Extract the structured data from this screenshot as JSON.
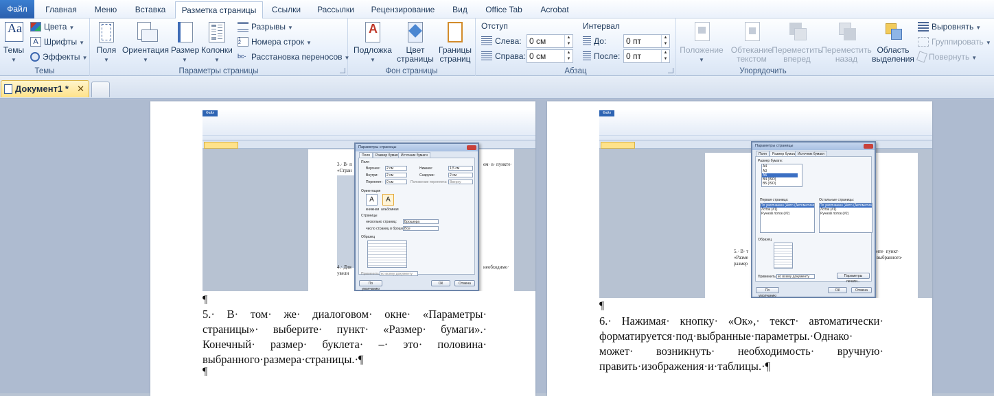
{
  "ribbon": {
    "tabs": [
      "Файл",
      "Главная",
      "Меню",
      "Вставка",
      "Разметка страницы",
      "Ссылки",
      "Рассылки",
      "Рецензирование",
      "Вид",
      "Office Tab",
      "Acrobat"
    ],
    "active_tab": "Разметка страницы",
    "groups": {
      "themes": {
        "label": "Темы",
        "themes_btn": "Темы",
        "colors": "Цвета",
        "fonts": "Шрифты",
        "effects": "Эффекты"
      },
      "page_setup": {
        "label": "Параметры страницы",
        "fields": "Поля",
        "orientation": "Ориентация",
        "size": "Размер",
        "columns": "Колонки",
        "breaks": "Разрывы",
        "line_numbers": "Номера строк",
        "hyphenation": "Расстановка переносов"
      },
      "page_background": {
        "label": "Фон страницы",
        "watermark": "Подложка",
        "page_color": "Цвет\nстраницы",
        "page_borders": "Границы\nстраниц"
      },
      "paragraph": {
        "label": "Абзац",
        "indent_title": "Отступ",
        "left_label": "Слева:",
        "left_value": "0 см",
        "right_label": "Справа:",
        "right_value": "0 см",
        "spacing_title": "Интервал",
        "before_label": "До:",
        "before_value": "0 пт",
        "after_label": "После:",
        "after_value": "0 пт"
      },
      "arrange": {
        "label": "Упорядочить",
        "position": "Положение",
        "wrap_text": "Обтекание\nтекстом",
        "bring_forward": "Переместить\nвперед",
        "send_backward": "Переместить\nназад",
        "selection_pane": "Область\nвыделения",
        "align": "Выровнять",
        "group": "Группировать",
        "rotate": "Повернуть"
      }
    }
  },
  "document_tabs": {
    "active": "Документ1 *",
    "close_glyph": "✕"
  },
  "page_left": {
    "para_text": "5.· В· том· же· диалоговом· окне· «Параметры· страницы»· выберите· пункт· «Размер· бумаги».· Конечный· размер· буклета· –· это· половина· выбранного·размера·страницы.·¶",
    "pilcrow": "¶",
    "screenshot": {
      "dialog_title": "Параметры страницы",
      "tabs": [
        "Поля",
        "Размер бумаги",
        "Источник бумаги"
      ],
      "section_fields": "Поля",
      "top_label": "Верхнее:",
      "top_value": "2 см",
      "bottom_label": "Нижнее:",
      "bottom_value": "1,5 см",
      "inner_label": "Внутри:",
      "inner_value": "2 см",
      "outer_label": "Снаружи:",
      "outer_value": "2 см",
      "gutter_label": "Переплет:",
      "gutter_value": "0 см",
      "gutter_pos_label": "Положение переплета:",
      "gutter_pos_value": "Вверху",
      "section_orientation": "Ориентация",
      "portrait": "книжная",
      "landscape": "альбомная",
      "section_pages": "Страницы",
      "multiple_label": "несколько страниц:",
      "multiple_value": "Брошюра",
      "sheets_label": "число страниц в брошюре:",
      "sheets_value": "Все",
      "section_sample": "Образец",
      "apply_label": "Применить:",
      "apply_value": "ко всему документу",
      "default_btn": "По умолчанию",
      "ok_btn": "ОК",
      "cancel_btn": "Отмена",
      "bg_text_1": "3.· В· п",
      "bg_text_1b": "ем· в· пункте·",
      "bg_text_2": "«Стран",
      "bg_text_3": "4.· Для",
      "bg_text_3b": "необходимо·",
      "bg_text_4": "увели"
    }
  },
  "page_right": {
    "para_text": "6.· Нажимая· кнопку· «Ок»,· текст· автоматически· форматируется·под·выбранные·параметры.·Однако· может· возникнуть· необходимость· вручную· править·изображения·и·таблицы.·¶",
    "pilcrow": "¶",
    "screenshot": {
      "dialog_title": "Параметры страницы",
      "tabs": [
        "Поля",
        "Размер бумаги",
        "Источник бумаги"
      ],
      "paper_size_label": "Размер бумаги:",
      "paper_sizes": [
        "A4",
        "A3",
        "A5",
        "B4 (ISO)",
        "B5 (ISO)"
      ],
      "first_page_label": "Первая страница:",
      "first_page_items": [
        "По умолчанию (Авто (Автоматический выбор))",
        "Лоток (#1)",
        "Ручной лоток (#2)"
      ],
      "other_pages_label": "Остальные страницы:",
      "other_pages_items": [
        "По умолчанию (Авто (Автоматический выбор))",
        "Лоток (#1)",
        "Ручной лоток (#2)"
      ],
      "section_sample": "Образец",
      "apply_label": "Применить:",
      "apply_value": "ко всему документу",
      "print_options_btn": "Параметры печати...",
      "default_btn": "По умолчанию",
      "ok_btn": "ОК",
      "cancel_btn": "Отмена",
      "bg_text_1": "5.· В· т",
      "bg_text_1b": "ерите· пункт·",
      "bg_text_2": "«Разме",
      "bg_text_2b": "выбранного·",
      "bg_text_3": "размер"
    }
  },
  "colors": {
    "accent": "#2a5fae",
    "doc_tab": "#ffe28a",
    "workspace": "#aebbd0"
  },
  "icons": [
    "themes-icon",
    "colors-icon",
    "fonts-icon",
    "effects-icon",
    "margins-icon",
    "orientation-icon",
    "size-icon",
    "columns-icon",
    "breaks-icon",
    "line-numbers-icon",
    "hyphenation-icon",
    "watermark-icon",
    "page-color-icon",
    "page-borders-icon",
    "position-icon",
    "wrap-text-icon",
    "bring-forward-icon",
    "send-backward-icon",
    "selection-pane-icon",
    "align-icon",
    "group-icon",
    "rotate-icon",
    "document-icon"
  ]
}
